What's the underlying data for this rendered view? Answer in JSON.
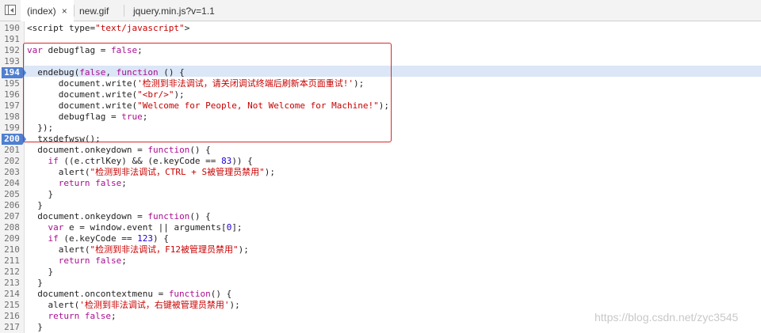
{
  "tabs": [
    {
      "label": "(index)",
      "active": true,
      "close_glyph": "×"
    },
    {
      "label": "new.gif",
      "active": false
    },
    {
      "label": "jquery.min.js?v=1.1",
      "active": false
    }
  ],
  "breakpoint_lines": [
    "194",
    "200"
  ],
  "lines": [
    {
      "num": "190",
      "text": "<script type=\"text/javascript\">"
    },
    {
      "num": "191",
      "text": ""
    },
    {
      "num": "192",
      "text": "var debugflag = false;"
    },
    {
      "num": "193",
      "text": ""
    },
    {
      "num": "194",
      "text": "  endebug(false, function () {"
    },
    {
      "num": "195",
      "text": "      document.write('检测到非法调试，请关闭调试终端后刷新本页面重试!');"
    },
    {
      "num": "196",
      "text": "      document.write(\"<br/>\");"
    },
    {
      "num": "197",
      "text": "      document.write(\"Welcome for People, Not Welcome for Machine!\");"
    },
    {
      "num": "198",
      "text": "      debugflag = true;"
    },
    {
      "num": "199",
      "text": "  });"
    },
    {
      "num": "200",
      "text": "  txsdefwsw();"
    },
    {
      "num": "201",
      "text": "  document.onkeydown = function() {"
    },
    {
      "num": "202",
      "text": "    if ((e.ctrlKey) && (e.keyCode == 83)) {"
    },
    {
      "num": "203",
      "text": "      alert(\"检测到非法调试，CTRL + S被管理员禁用\");"
    },
    {
      "num": "204",
      "text": "      return false;"
    },
    {
      "num": "205",
      "text": "    }"
    },
    {
      "num": "206",
      "text": "  }"
    },
    {
      "num": "207",
      "text": "  document.onkeydown = function() {"
    },
    {
      "num": "208",
      "text": "    var e = window.event || arguments[0];"
    },
    {
      "num": "209",
      "text": "    if (e.keyCode == 123) {"
    },
    {
      "num": "210",
      "text": "      alert(\"检测到非法调试，F12被管理员禁用\");"
    },
    {
      "num": "211",
      "text": "      return false;"
    },
    {
      "num": "212",
      "text": "    }"
    },
    {
      "num": "213",
      "text": "  }"
    },
    {
      "num": "214",
      "text": "  document.oncontextmenu = function() {"
    },
    {
      "num": "215",
      "text": "    alert('检测到非法调试，右键被管理员禁用');"
    },
    {
      "num": "216",
      "text": "    return false;"
    },
    {
      "num": "217",
      "text": "  }"
    }
  ],
  "watermark": "https://blog.csdn.net/zyc3545",
  "colors": {
    "breakpoint": "#4f7fd1",
    "highlight_box": "#d9282b",
    "keyword": "#aa0d91",
    "string": "#c80000",
    "number": "#1c00cf"
  }
}
